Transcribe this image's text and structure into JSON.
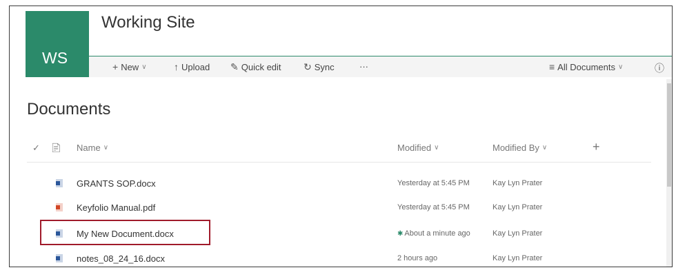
{
  "site": {
    "logo": "WS",
    "title": "Working Site"
  },
  "commandbar": {
    "new_label": "New",
    "upload_label": "Upload",
    "quickedit_label": "Quick edit",
    "sync_label": "Sync",
    "more_label": "···",
    "view_label": "All Documents"
  },
  "library": {
    "title": "Documents",
    "columns": {
      "name": "Name",
      "modified": "Modified",
      "modified_by": "Modified By"
    },
    "rows": [
      {
        "name": "GRANTS SOP.docx",
        "type": "word",
        "modified": "Yesterday at 5:45 PM",
        "modified_by": "Kay Lyn Prater",
        "is_new": false
      },
      {
        "name": "Keyfolio Manual.pdf",
        "type": "pdf",
        "modified": "Yesterday at 5:45 PM",
        "modified_by": "Kay Lyn Prater",
        "is_new": false
      },
      {
        "name": "My New Document.docx",
        "type": "word",
        "modified": "About a minute ago",
        "modified_by": "Kay Lyn Prater",
        "is_new": true,
        "highlighted": true
      },
      {
        "name": "notes_08_24_16.docx",
        "type": "word",
        "modified": "2 hours ago",
        "modified_by": "Kay Lyn Prater",
        "is_new": false
      }
    ]
  },
  "colors": {
    "brand": "#2b8a6a",
    "word": "#2b579a",
    "pdf": "#d24726",
    "highlight": "#a01a2a"
  }
}
